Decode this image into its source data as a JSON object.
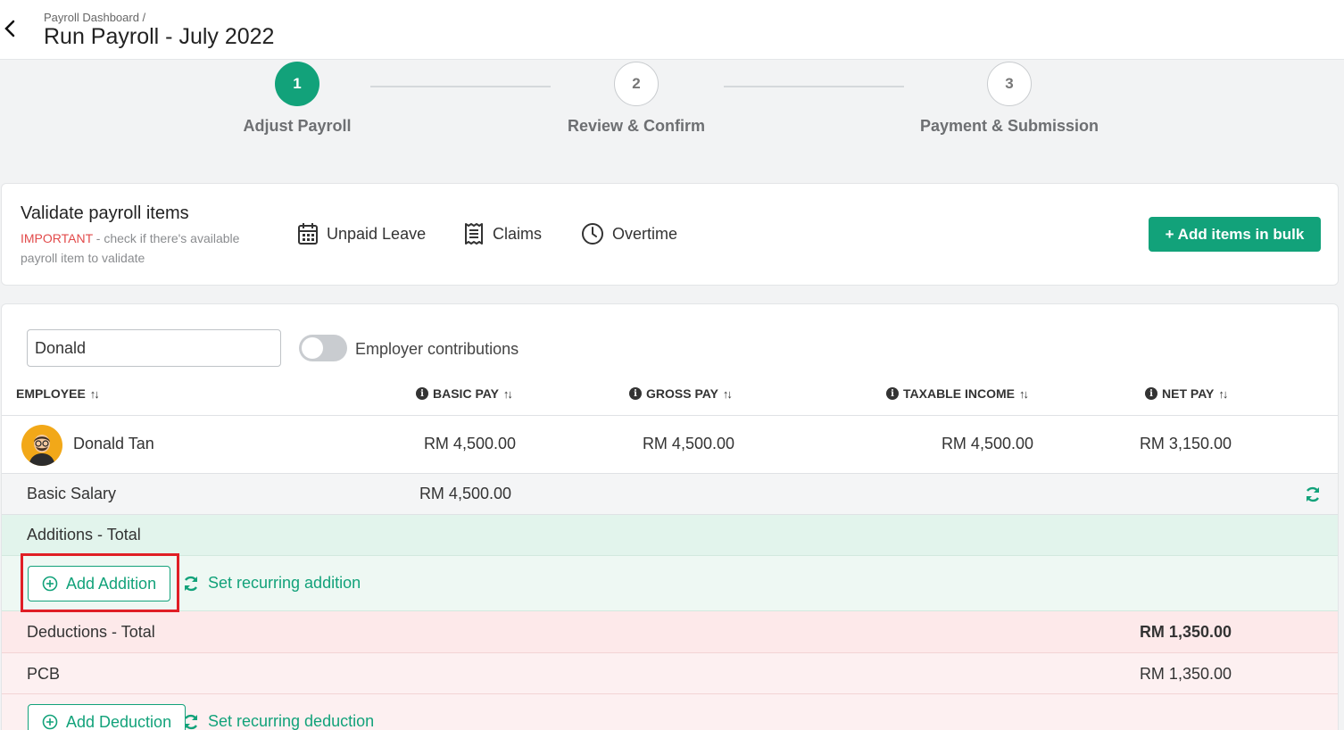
{
  "header": {
    "breadcrumb": "Payroll Dashboard /",
    "title": "Run Payroll - July 2022"
  },
  "steps": [
    {
      "number": "1",
      "label": "Adjust Payroll",
      "state": "active"
    },
    {
      "number": "2",
      "label": "Review & Confirm",
      "state": "todo"
    },
    {
      "number": "3",
      "label": "Payment & Submission",
      "state": "todo"
    }
  ],
  "validate": {
    "title": "Validate payroll items",
    "important": "IMPORTANT",
    "note": " - check if there's available payroll item to validate",
    "items": [
      "Unpaid Leave",
      "Claims",
      "Overtime"
    ],
    "bulk_button": "+ Add items in bulk"
  },
  "filters": {
    "search_value": "Donald",
    "toggle_label": "Employer contributions",
    "toggle_on": false
  },
  "table": {
    "columns": [
      "EMPLOYEE",
      "BASIC PAY",
      "GROSS PAY",
      "TAXABLE INCOME",
      "NET PAY"
    ],
    "employee": {
      "name": "Donald Tan",
      "basic_pay": "RM 4,500.00",
      "gross_pay": "RM 4,500.00",
      "taxable_income": "RM 4,500.00",
      "net_pay": "RM 3,150.00"
    }
  },
  "details": {
    "basic_salary_label": "Basic Salary",
    "basic_salary_value": "RM 4,500.00",
    "additions_label": "Additions - Total",
    "add_addition": "Add Addition",
    "set_recurring_addition": "Set recurring addition",
    "deductions_label": "Deductions - Total",
    "deductions_total": "RM 1,350.00",
    "pcb_label": "PCB",
    "pcb_value": "RM 1,350.00",
    "add_deduction": "Add Deduction",
    "set_recurring_deduction": "Set recurring deduction"
  },
  "colors": {
    "accent": "#12a27a",
    "additions_bg": "#e2f4ec",
    "deductions_bg": "#fde9ea",
    "highlight": "#e01e25"
  }
}
